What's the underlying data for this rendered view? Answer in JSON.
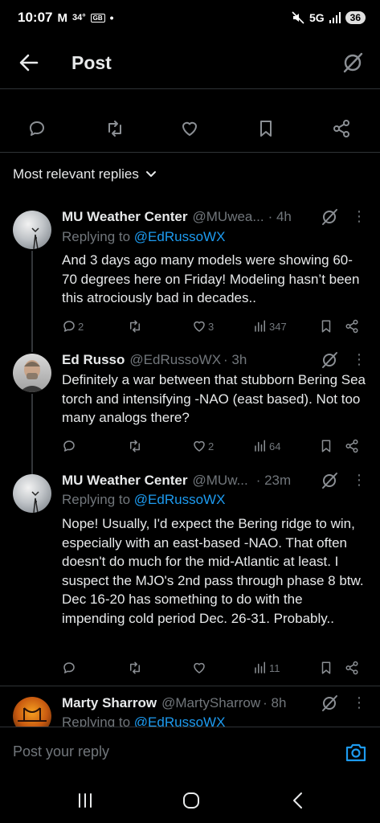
{
  "status_bar": {
    "time": "10:07",
    "mail_icon": "M",
    "temp": "34°",
    "gb": "GB",
    "dot": "•",
    "network": "5G",
    "battery": "36"
  },
  "header": {
    "title": "Post"
  },
  "sort": {
    "label": "Most relevant replies"
  },
  "replies": [
    {
      "name": "MU Weather Center",
      "handle": "@MUwea...",
      "time": "· 4h",
      "replying_prefix": "Replying to ",
      "replying_to": "@EdRussoWX",
      "body": "And 3 days ago many models were showing 60-70 degrees here on Friday! Modeling hasn’t been this atrociously bad in decades..",
      "replies_count": "2",
      "reposts_count": "",
      "likes_count": "3",
      "views_count": "347"
    },
    {
      "name": "Ed Russo",
      "handle": "@EdRussoWX",
      "time": "· 3h",
      "body": "Definitely a war between that stubborn Bering Sea torch and intensifying -NAO (east based). Not too many analogs there?",
      "replies_count": "",
      "reposts_count": "",
      "likes_count": "2",
      "views_count": "64"
    },
    {
      "name": "MU Weather Center",
      "handle": "@MUw...",
      "time": "· 23m",
      "replying_prefix": "Replying to ",
      "replying_to": "@EdRussoWX",
      "body": "Nope! Usually, I'd expect the Bering ridge to win, especially with an east-based -NAO. That often doesn't do much for the mid-Atlantic at least. I suspect the MJO's 2nd pass through phase 8 btw. Dec 16-20 has something to do with the impending cold period Dec. 26-31. Probably..",
      "replies_count": "",
      "reposts_count": "",
      "likes_count": "",
      "views_count": "11"
    },
    {
      "name": "Marty Sharrow",
      "handle": "@MartySharrow",
      "time": "· 8h",
      "replying_prefix": "Replying to ",
      "replying_to": "@EdRussoWX"
    }
  ],
  "compose": {
    "placeholder": "Post your reply"
  },
  "colors": {
    "background": "#000000",
    "text": "#e7e9ea",
    "muted": "#71767b",
    "link": "#1d9bf0",
    "divider": "#2f3336"
  },
  "icons": {
    "back": "arrow-left-icon",
    "grok": "grok-icon",
    "reply": "reply-icon",
    "repost": "repost-icon",
    "like": "heart-icon",
    "bookmark": "bookmark-icon",
    "share": "share-icon",
    "views": "views-icon",
    "camera": "camera-icon"
  }
}
